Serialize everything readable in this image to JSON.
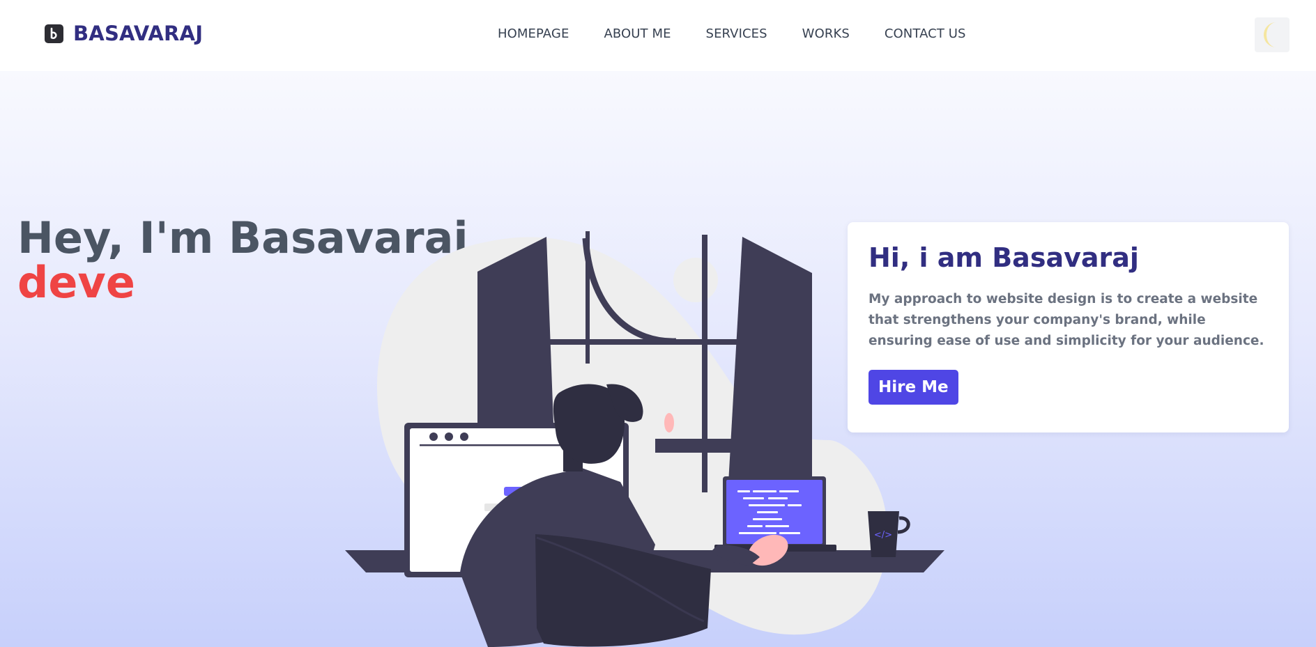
{
  "brand": {
    "logo_letter": "b",
    "name": "BASAVARAJ"
  },
  "nav": {
    "items": [
      {
        "label": "HOMEPAGE"
      },
      {
        "label": "ABOUT ME"
      },
      {
        "label": "SERVICES"
      },
      {
        "label": "WORKS"
      },
      {
        "label": "CONTACT US"
      }
    ],
    "theme_toggle_icon": "moon-icon"
  },
  "hero": {
    "title": "Hey, I'm Basavaraj",
    "typed_text": "deve",
    "laptop_glyph": "</>"
  },
  "intro": {
    "heading": "Hi, i am Basavaraj",
    "description": "My approach to website design is to create a website that strengthens your company's brand, while ensuring ease of use and simplicity for your audience.",
    "cta_label": "Hire Me"
  },
  "colors": {
    "brand": "#312e81",
    "accent": "#4f46e5",
    "typed": "#ef4444",
    "moon": "#f5e6a0"
  }
}
